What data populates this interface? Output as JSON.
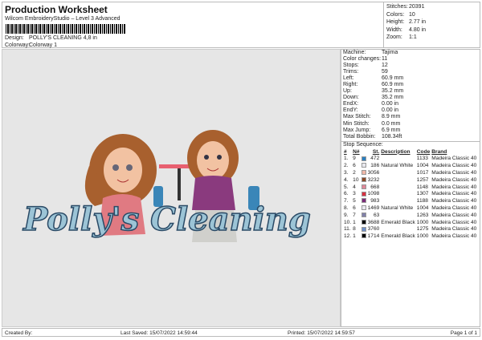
{
  "header": {
    "title": "Production Worksheet",
    "subtitle": "Wilcom EmbroideryStudio – Level 3 Advanced",
    "design_label": "Design:",
    "design_value": "POLLY'S CLEANING 4,8 in",
    "colorway_label": "Colorway:",
    "colorway_value": "Colorway 1"
  },
  "stats": [
    {
      "k": "Stitches:",
      "v": "20391"
    },
    {
      "k": "Colors:",
      "v": "10"
    },
    {
      "k": "Height:",
      "v": "2.77 in"
    },
    {
      "k": "Width:",
      "v": "4.80 in"
    },
    {
      "k": "Zoom:",
      "v": "1:1"
    }
  ],
  "machine": [
    {
      "k": "Machine:",
      "v": "Tajima"
    },
    {
      "k": "Color changes:",
      "v": "11"
    },
    {
      "k": "Stops:",
      "v": "12"
    },
    {
      "k": "Trims:",
      "v": "59"
    },
    {
      "k": "Left:",
      "v": "60.9 mm"
    },
    {
      "k": "Right:",
      "v": "60.9 mm"
    },
    {
      "k": "Up:",
      "v": "35.2 mm"
    },
    {
      "k": "Down:",
      "v": "35.2 mm"
    },
    {
      "k": "EndX:",
      "v": "0.00 in"
    },
    {
      "k": "EndY:",
      "v": "0.00 in"
    },
    {
      "k": "Max Stitch:",
      "v": "8.9 mm"
    },
    {
      "k": "Min Stitch:",
      "v": "0.0 mm"
    },
    {
      "k": "Max Jump:",
      "v": "6.9 mm"
    },
    {
      "k": "Total Bobbin:",
      "v": "108.34ft"
    }
  ],
  "stop_sequence": {
    "title": "Stop Sequence:",
    "headers": [
      "#",
      "N#",
      "St.",
      "Description",
      "Code",
      "Brand"
    ],
    "rows": [
      {
        "n": "1.",
        "nn": "9",
        "color": "#2a7fc0",
        "st": "472",
        "desc": "",
        "code": "1133",
        "brand": "Madeira Classic 40"
      },
      {
        "n": "2.",
        "nn": "6",
        "color": "#e8e8ee",
        "st": "186",
        "desc": "Natural White",
        "code": "1004",
        "brand": "Madeira Classic 40"
      },
      {
        "n": "3.",
        "nn": "2",
        "color": "#f0b8a8",
        "st": "3056",
        "desc": "",
        "code": "1017",
        "brand": "Madeira Classic 40"
      },
      {
        "n": "4.",
        "nn": "10",
        "color": "#8b4a28",
        "st": "3232",
        "desc": "",
        "code": "1257",
        "brand": "Madeira Classic 40"
      },
      {
        "n": "5.",
        "nn": "4",
        "color": "#e08898",
        "st": "668",
        "desc": "",
        "code": "1148",
        "brand": "Madeira Classic 40"
      },
      {
        "n": "6.",
        "nn": "3",
        "color": "#d83040",
        "st": "1098",
        "desc": "",
        "code": "1307",
        "brand": "Madeira Classic 40"
      },
      {
        "n": "7.",
        "nn": "5",
        "color": "#7a2a78",
        "st": "983",
        "desc": "",
        "code": "1188",
        "brand": "Madeira Classic 40"
      },
      {
        "n": "8.",
        "nn": "6",
        "color": "#e8e8ee",
        "st": "1469",
        "desc": "Natural White",
        "code": "1004",
        "brand": "Madeira Classic 40"
      },
      {
        "n": "9.",
        "nn": "7",
        "color": "#8080a8",
        "st": "63",
        "desc": "",
        "code": "1263",
        "brand": "Madeira Classic 40"
      },
      {
        "n": "10.",
        "nn": "1",
        "color": "#000000",
        "st": "3688",
        "desc": "Emerald Black",
        "code": "1000",
        "brand": "Madeira Classic 40"
      },
      {
        "n": "11.",
        "nn": "8",
        "color": "#7090c8",
        "st": "3760",
        "desc": "",
        "code": "1275",
        "brand": "Madeira Classic 40"
      },
      {
        "n": "12.",
        "nn": "1",
        "color": "#000000",
        "st": "1714",
        "desc": "Emerald Black",
        "code": "1000",
        "brand": "Madeira Classic 40"
      }
    ]
  },
  "design": {
    "text": "Polly's Cleaning"
  },
  "footer": {
    "created": "Created By:",
    "saved": "Last Saved: 15/07/2022 14:59:44",
    "printed": "Printed: 15/07/2022 14:59:57",
    "page": "Page 1 of 1"
  }
}
